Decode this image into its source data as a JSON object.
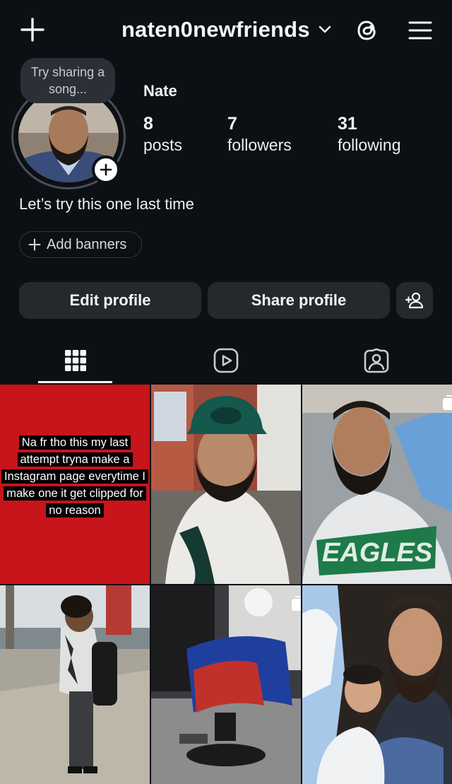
{
  "header": {
    "username": "naten0newfriends",
    "icons": [
      "plus-icon",
      "chevron-down-icon",
      "threads-icon",
      "menu-icon"
    ]
  },
  "profile": {
    "note": "Try sharing a song...",
    "display_name": "Nate",
    "bio": "Let’s try this one last time",
    "stats": {
      "posts": {
        "value": "8",
        "label": "posts"
      },
      "followers": {
        "value": "7",
        "label": "followers"
      },
      "following": {
        "value": "31",
        "label": "following"
      }
    },
    "add_banners_label": "Add banners"
  },
  "actions": {
    "edit_label": "Edit profile",
    "share_label": "Share profile"
  },
  "tabs": [
    "grid-icon",
    "reels-icon",
    "tagged-icon"
  ],
  "posts": [
    {
      "kind": "text",
      "text": "Na fr tho this my last attempt tryna make a Instagram page everytime I make one it get clipped for no reason",
      "background": "#c8141b"
    },
    {
      "kind": "photo",
      "subject": "man in green cap and white baseball jersey"
    },
    {
      "kind": "photo",
      "subject": "man in car wearing Eagles hoodie",
      "carousel": true
    },
    {
      "kind": "photo",
      "subject": "boy on street with backpack"
    },
    {
      "kind": "photo",
      "subject": "barbershop chair",
      "carousel": true
    },
    {
      "kind": "photo",
      "subject": "man and boy selfie"
    }
  ],
  "colors": {
    "background": "#0c1014",
    "button": "#25292e",
    "text": "#f5f5f5"
  }
}
